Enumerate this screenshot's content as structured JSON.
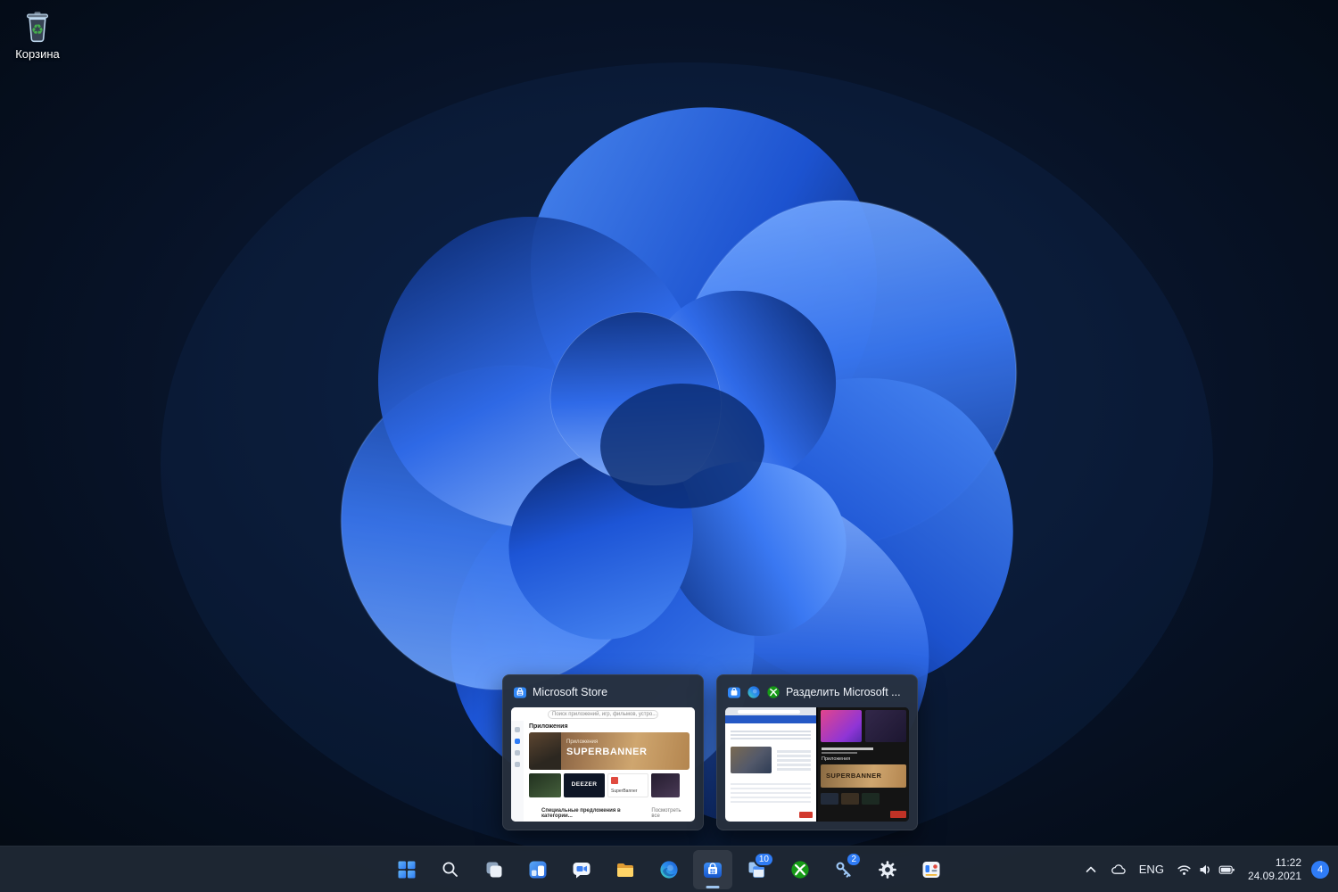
{
  "desktop": {
    "recycle_bin_label": "Корзина"
  },
  "flyout": {
    "cards": [
      {
        "title": "Microsoft Store",
        "icons": [
          "store-icon"
        ],
        "thumb": {
          "search": "Поиск приложений, игр, фильмов, устро...",
          "heading": "Приложения",
          "banner_sub": "Приложения",
          "banner_title": "SUPERBANNER",
          "tile_deezer": "DEEZER",
          "tile_super": "SuperBanner",
          "footer": "Специальные предложения в категории...",
          "footer_link": "Посмотреть все"
        }
      },
      {
        "title": "Разделить Microsoft ...",
        "icons": [
          "store-icon",
          "edge-icon",
          "xbox-icon"
        ],
        "thumb": {
          "right_heading": "Приложения",
          "right_banner": "SUPERBANNER"
        }
      }
    ]
  },
  "taskbar": {
    "buttons": [
      {
        "icon": "windows-logo"
      },
      {
        "icon": "magnifier"
      },
      {
        "icon": "task-view-squares"
      },
      {
        "icon": "widgets-panel"
      },
      {
        "icon": "chat-bubble-camera"
      },
      {
        "icon": "folder"
      },
      {
        "icon": "edge-sphere"
      },
      {
        "icon": "store-bag",
        "open": true
      },
      {
        "icon": "stacked-windows",
        "badge": "10"
      },
      {
        "icon": "xbox-sphere"
      },
      {
        "icon": "key",
        "badge": "2"
      },
      {
        "icon": "gear"
      },
      {
        "icon": "colorful-panel"
      }
    ],
    "tray": {
      "language": "ENG",
      "time": "11:22",
      "date": "24.09.2021",
      "notifications": "4"
    }
  }
}
